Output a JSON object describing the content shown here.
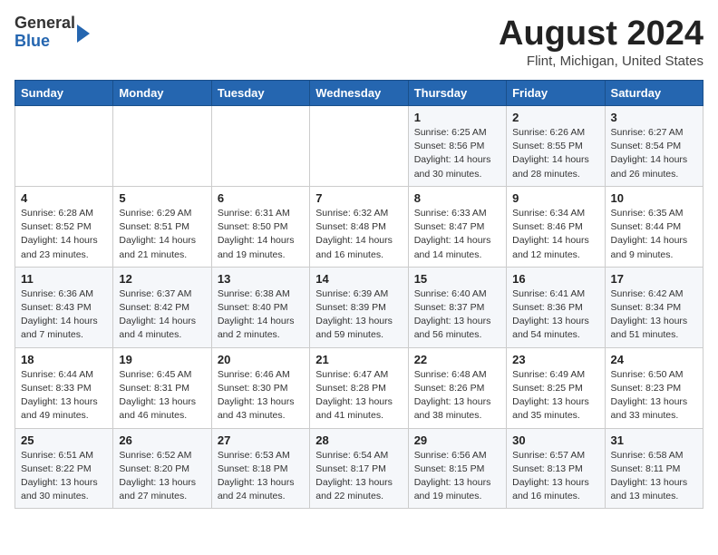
{
  "header": {
    "logo": {
      "general": "General",
      "blue": "Blue"
    },
    "title": "August 2024",
    "location": "Flint, Michigan, United States"
  },
  "weekdays": [
    "Sunday",
    "Monday",
    "Tuesday",
    "Wednesday",
    "Thursday",
    "Friday",
    "Saturday"
  ],
  "weeks": [
    [
      {
        "day": "",
        "info": ""
      },
      {
        "day": "",
        "info": ""
      },
      {
        "day": "",
        "info": ""
      },
      {
        "day": "",
        "info": ""
      },
      {
        "day": "1",
        "info": "Sunrise: 6:25 AM\nSunset: 8:56 PM\nDaylight: 14 hours\nand 30 minutes."
      },
      {
        "day": "2",
        "info": "Sunrise: 6:26 AM\nSunset: 8:55 PM\nDaylight: 14 hours\nand 28 minutes."
      },
      {
        "day": "3",
        "info": "Sunrise: 6:27 AM\nSunset: 8:54 PM\nDaylight: 14 hours\nand 26 minutes."
      }
    ],
    [
      {
        "day": "4",
        "info": "Sunrise: 6:28 AM\nSunset: 8:52 PM\nDaylight: 14 hours\nand 23 minutes."
      },
      {
        "day": "5",
        "info": "Sunrise: 6:29 AM\nSunset: 8:51 PM\nDaylight: 14 hours\nand 21 minutes."
      },
      {
        "day": "6",
        "info": "Sunrise: 6:31 AM\nSunset: 8:50 PM\nDaylight: 14 hours\nand 19 minutes."
      },
      {
        "day": "7",
        "info": "Sunrise: 6:32 AM\nSunset: 8:48 PM\nDaylight: 14 hours\nand 16 minutes."
      },
      {
        "day": "8",
        "info": "Sunrise: 6:33 AM\nSunset: 8:47 PM\nDaylight: 14 hours\nand 14 minutes."
      },
      {
        "day": "9",
        "info": "Sunrise: 6:34 AM\nSunset: 8:46 PM\nDaylight: 14 hours\nand 12 minutes."
      },
      {
        "day": "10",
        "info": "Sunrise: 6:35 AM\nSunset: 8:44 PM\nDaylight: 14 hours\nand 9 minutes."
      }
    ],
    [
      {
        "day": "11",
        "info": "Sunrise: 6:36 AM\nSunset: 8:43 PM\nDaylight: 14 hours\nand 7 minutes."
      },
      {
        "day": "12",
        "info": "Sunrise: 6:37 AM\nSunset: 8:42 PM\nDaylight: 14 hours\nand 4 minutes."
      },
      {
        "day": "13",
        "info": "Sunrise: 6:38 AM\nSunset: 8:40 PM\nDaylight: 14 hours\nand 2 minutes."
      },
      {
        "day": "14",
        "info": "Sunrise: 6:39 AM\nSunset: 8:39 PM\nDaylight: 13 hours\nand 59 minutes."
      },
      {
        "day": "15",
        "info": "Sunrise: 6:40 AM\nSunset: 8:37 PM\nDaylight: 13 hours\nand 56 minutes."
      },
      {
        "day": "16",
        "info": "Sunrise: 6:41 AM\nSunset: 8:36 PM\nDaylight: 13 hours\nand 54 minutes."
      },
      {
        "day": "17",
        "info": "Sunrise: 6:42 AM\nSunset: 8:34 PM\nDaylight: 13 hours\nand 51 minutes."
      }
    ],
    [
      {
        "day": "18",
        "info": "Sunrise: 6:44 AM\nSunset: 8:33 PM\nDaylight: 13 hours\nand 49 minutes."
      },
      {
        "day": "19",
        "info": "Sunrise: 6:45 AM\nSunset: 8:31 PM\nDaylight: 13 hours\nand 46 minutes."
      },
      {
        "day": "20",
        "info": "Sunrise: 6:46 AM\nSunset: 8:30 PM\nDaylight: 13 hours\nand 43 minutes."
      },
      {
        "day": "21",
        "info": "Sunrise: 6:47 AM\nSunset: 8:28 PM\nDaylight: 13 hours\nand 41 minutes."
      },
      {
        "day": "22",
        "info": "Sunrise: 6:48 AM\nSunset: 8:26 PM\nDaylight: 13 hours\nand 38 minutes."
      },
      {
        "day": "23",
        "info": "Sunrise: 6:49 AM\nSunset: 8:25 PM\nDaylight: 13 hours\nand 35 minutes."
      },
      {
        "day": "24",
        "info": "Sunrise: 6:50 AM\nSunset: 8:23 PM\nDaylight: 13 hours\nand 33 minutes."
      }
    ],
    [
      {
        "day": "25",
        "info": "Sunrise: 6:51 AM\nSunset: 8:22 PM\nDaylight: 13 hours\nand 30 minutes."
      },
      {
        "day": "26",
        "info": "Sunrise: 6:52 AM\nSunset: 8:20 PM\nDaylight: 13 hours\nand 27 minutes."
      },
      {
        "day": "27",
        "info": "Sunrise: 6:53 AM\nSunset: 8:18 PM\nDaylight: 13 hours\nand 24 minutes."
      },
      {
        "day": "28",
        "info": "Sunrise: 6:54 AM\nSunset: 8:17 PM\nDaylight: 13 hours\nand 22 minutes."
      },
      {
        "day": "29",
        "info": "Sunrise: 6:56 AM\nSunset: 8:15 PM\nDaylight: 13 hours\nand 19 minutes."
      },
      {
        "day": "30",
        "info": "Sunrise: 6:57 AM\nSunset: 8:13 PM\nDaylight: 13 hours\nand 16 minutes."
      },
      {
        "day": "31",
        "info": "Sunrise: 6:58 AM\nSunset: 8:11 PM\nDaylight: 13 hours\nand 13 minutes."
      }
    ]
  ]
}
